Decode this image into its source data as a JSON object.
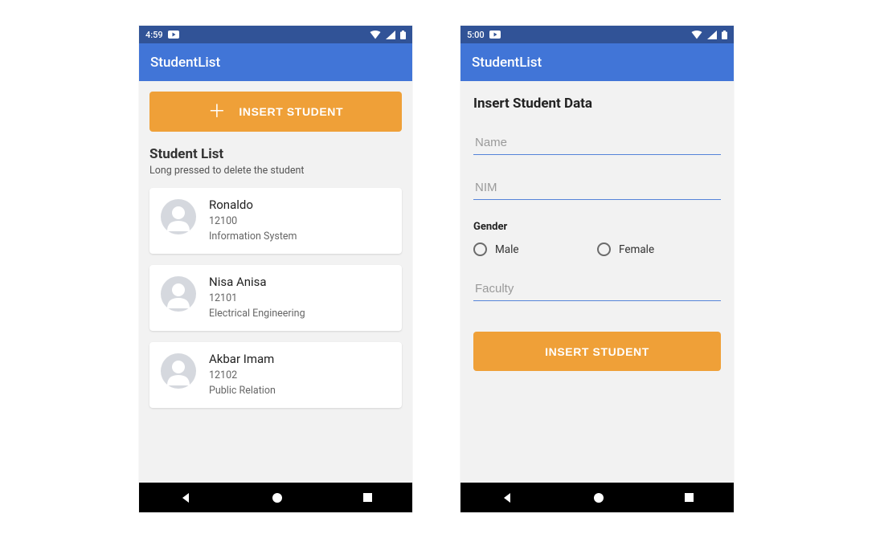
{
  "left": {
    "status": {
      "time": "4:59"
    },
    "app_title": "StudentList",
    "insert_button": "INSERT STUDENT",
    "section_title": "Student List",
    "hint": "Long pressed to delete the student",
    "students": [
      {
        "name": "Ronaldo",
        "nim": "12100",
        "faculty": "Information System"
      },
      {
        "name": "Nisa Anisa",
        "nim": "12101",
        "faculty": "Electrical Engineering"
      },
      {
        "name": "Akbar Imam",
        "nim": "12102",
        "faculty": "Public Relation"
      }
    ]
  },
  "right": {
    "status": {
      "time": "5:00"
    },
    "app_title": "StudentList",
    "form_title": "Insert Student Data",
    "name_placeholder": "Name",
    "nim_placeholder": "NIM",
    "gender_label": "Gender",
    "gender_options": {
      "male": "Male",
      "female": "Female"
    },
    "faculty_placeholder": "Faculty",
    "submit_button": "INSERT STUDENT"
  }
}
